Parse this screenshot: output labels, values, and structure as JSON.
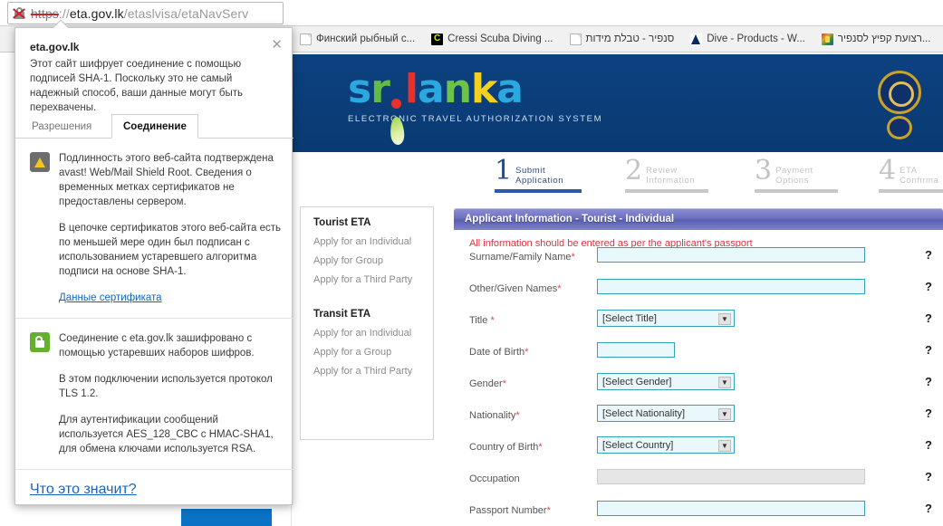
{
  "browser": {
    "omnibox": {
      "security_icon": "crossed-out-lock-icon",
      "scheme": "https",
      "separator": "://",
      "host": "eta.gov.lk",
      "path": "/etaslvisa/etaNavServ"
    },
    "bookmarks": [
      {
        "label": "Финский рыбный с...",
        "icon": "document-favicon"
      },
      {
        "label": "Cressi Scuba Diving ...",
        "icon": "cressi-favicon"
      },
      {
        "label": "סנפיר - טבלת מידות",
        "icon": "document-favicon"
      },
      {
        "label": "Dive - Products - W...",
        "icon": "dive-favicon"
      },
      {
        "label": "רצועת קפיץ לסנפיר...",
        "icon": "multicolor-favicon"
      }
    ]
  },
  "security_popup": {
    "title": "eta.gov.lk",
    "summary": "Этот сайт шифрует соединение с помощью подписей SHA-1. Поскольку это не самый надежный способ, ваши данные могут быть перехвачены.",
    "close_label": "✕",
    "tabs": [
      {
        "label": "Разрешения",
        "active": false
      },
      {
        "label": "Соединение",
        "active": true
      }
    ],
    "identity": {
      "icon": "warning-shield-icon",
      "paragraph_1": "Подлинность этого веб-сайта подтверждена avast! Web/Mail Shield Root. Сведения о временных метках сертификатов не предоставлены сервером.",
      "paragraph_2": "В цепочке сертификатов этого веб-сайта есть по меньшей мере один был подписан с использованием устаревшего алгоритма подписи на основе SHA-1.",
      "link": "Данные сертификата"
    },
    "connection": {
      "icon": "green-lock-icon",
      "paragraph_1": "Соединение с eta.gov.lk зашифровано с помощью устаревших наборов шифров.",
      "paragraph_2": "В этом подключении используется протокол TLS 1.2.",
      "paragraph_3": "Для аутентификации сообщений используется AES_128_CBC с HMAC-SHA1, для обмена ключами используется RSA."
    },
    "footer_link": "Что это значит?"
  },
  "site": {
    "logo": {
      "letters": [
        {
          "char": "s",
          "color": "#2aa9e0"
        },
        {
          "char": "r",
          "color": "#63bb46"
        },
        {
          "char": "i",
          "color": "#e8312a"
        },
        {
          "char": "l",
          "color": "#e8312a"
        },
        {
          "char": "a",
          "color": "#2aa9e0"
        },
        {
          "char": "n",
          "color": "#6cc24a"
        },
        {
          "char": "k",
          "color": "#f6d01e"
        },
        {
          "char": "a",
          "color": "#2aa9e0"
        }
      ],
      "tagline": "ELECTRONIC TRAVEL AUTHORIZATION SYSTEM",
      "header_color": "#0b3f7d",
      "emblem": "sri-lanka-gold-emblem"
    },
    "steps": [
      {
        "num": "1",
        "line1": "Submit",
        "line2": "Application",
        "active": true
      },
      {
        "num": "2",
        "line1": "Review",
        "line2": "Information",
        "active": false
      },
      {
        "num": "3",
        "line1": "Payment",
        "line2": "Options",
        "active": false
      },
      {
        "num": "4",
        "line1": "ETA",
        "line2": "Confirma",
        "active": false
      }
    ],
    "menu": {
      "tourist_heading": "Tourist ETA",
      "tourist_items": [
        "Apply for an Individual",
        "Apply for Group",
        "Apply for a Third Party"
      ],
      "transit_heading": "Transit ETA",
      "transit_items": [
        "Apply for an Individual",
        "Apply for a Group",
        "Apply for a Third Party"
      ]
    },
    "panel": {
      "title": "Applicant Information - Tourist - Individual",
      "note": "All information should be entered as per the applicant's passport",
      "help_glyph": "?",
      "fields": [
        {
          "label": "Surname/Family Name",
          "required": true,
          "type": "text",
          "value": "",
          "width": "wide",
          "disabled": false
        },
        {
          "label": "Other/Given Names",
          "required": true,
          "type": "text",
          "value": "",
          "width": "wide",
          "disabled": false
        },
        {
          "label": "Title ",
          "required": true,
          "type": "select",
          "value": "[Select Title]"
        },
        {
          "label": "Date of Birth",
          "required": true,
          "type": "text",
          "value": "",
          "width": "short",
          "disabled": false
        },
        {
          "label": "Gender",
          "required": true,
          "type": "select",
          "value": "[Select Gender]"
        },
        {
          "label": "Nationality",
          "required": true,
          "type": "select",
          "value": "[Select Nationality]"
        },
        {
          "label": "Country of Birth",
          "required": true,
          "type": "select",
          "value": "[Select Country]"
        },
        {
          "label": "Occupation",
          "required": false,
          "type": "text",
          "value": "",
          "width": "wide",
          "disabled": true
        },
        {
          "label": "Passport Number",
          "required": true,
          "type": "text",
          "value": "",
          "width": "wide",
          "disabled": false
        }
      ],
      "select_arrow": "▼"
    }
  }
}
